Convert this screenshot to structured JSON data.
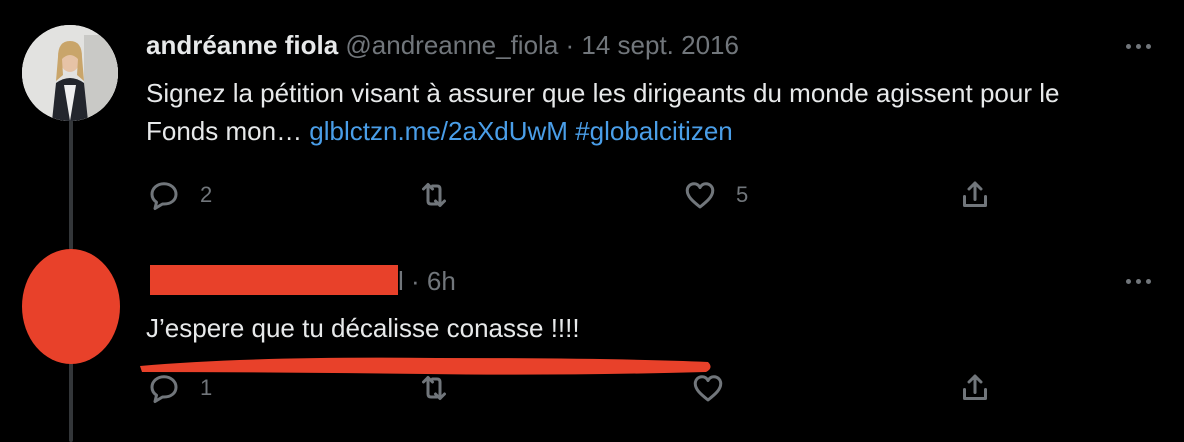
{
  "tweet1": {
    "display_name": "andréanne fiola",
    "handle": "@andreanne_fiola",
    "separator": " · ",
    "date": "14 sept. 2016",
    "text": "Signez la pétition visant à assurer que les dirigeants du monde agissent pour le Fonds mon… ",
    "link1": "glblctzn.me/2aXdUwM",
    "hashtag": "#globalcitizen",
    "reply_count": "2",
    "retweet_count": "",
    "like_count": "5"
  },
  "tweet2": {
    "handle_tail": "l",
    "separator": " · ",
    "time": "6h",
    "text": "J’espere que tu décalisse conasse !!!!",
    "reply_count": "1",
    "retweet_count": "",
    "like_count": ""
  },
  "colors": {
    "background": "#000000",
    "text": "#e7e9ea",
    "muted": "#71767b",
    "link": "#4a9ee8",
    "redaction": "#e8412a"
  },
  "icons": [
    "reply-icon",
    "retweet-icon",
    "like-icon",
    "share-icon",
    "more-icon"
  ]
}
